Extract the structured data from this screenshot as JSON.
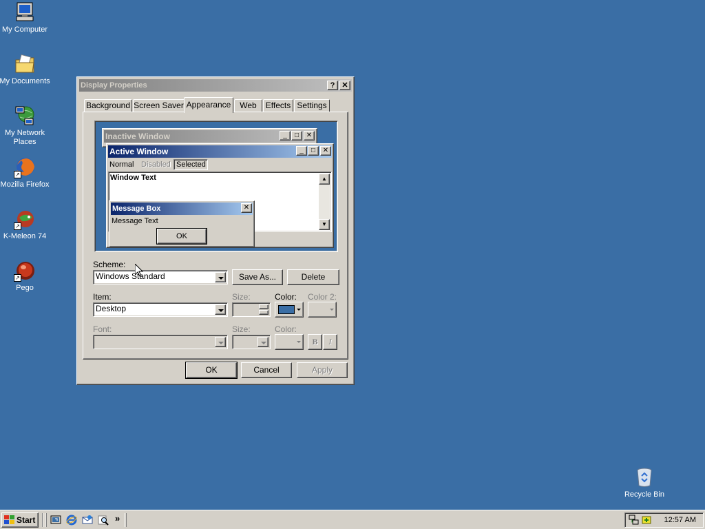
{
  "desktop": {
    "icons": [
      {
        "label": "My Computer",
        "icon": "computer-icon"
      },
      {
        "label": "My Documents",
        "icon": "documents-folder-icon"
      },
      {
        "label": "My Network Places",
        "icon": "network-places-icon"
      },
      {
        "label": "Mozilla Firefox",
        "icon": "firefox-icon"
      },
      {
        "label": "K-Meleon 74",
        "icon": "k-meleon-icon"
      },
      {
        "label": "Pego",
        "icon": "pego-icon"
      },
      {
        "label": "Recycle Bin",
        "icon": "recycle-bin-icon"
      }
    ],
    "background_color": "#3a6ea5"
  },
  "dialog": {
    "title": "Display Properties",
    "help_button": "?",
    "close_button": "✕",
    "tabs": [
      "Background",
      "Screen Saver",
      "Appearance",
      "Web",
      "Effects",
      "Settings"
    ],
    "active_tab": "Appearance",
    "preview": {
      "inactive_title": "Inactive Window",
      "active_title": "Active Window",
      "menu_normal": "Normal",
      "menu_disabled": "Disabled",
      "menu_selected": "Selected",
      "window_text": "Window Text",
      "msgbox_title": "Message Box",
      "msgbox_text": "Message Text",
      "msgbox_ok": "OK"
    },
    "scheme_label": "Scheme:",
    "scheme_value": "Windows Standard",
    "save_as_label": "Save As...",
    "delete_label": "Delete",
    "item_label": "Item:",
    "item_value": "Desktop",
    "size_label": "Size:",
    "color_label": "Color:",
    "color2_label": "Color 2:",
    "selected_color": "#3a6ea5",
    "font_label": "Font:",
    "font_size_label": "Size:",
    "font_color_label": "Color:",
    "bold_label": "B",
    "italic_label": "I",
    "ok_label": "OK",
    "cancel_label": "Cancel",
    "apply_label": "Apply"
  },
  "taskbar": {
    "start_label": "Start",
    "quick_launch": [
      "show-desktop-icon",
      "internet-explorer-icon",
      "outlook-express-icon",
      "search-icon"
    ],
    "overflow": "»",
    "clock": "12:57 AM"
  }
}
